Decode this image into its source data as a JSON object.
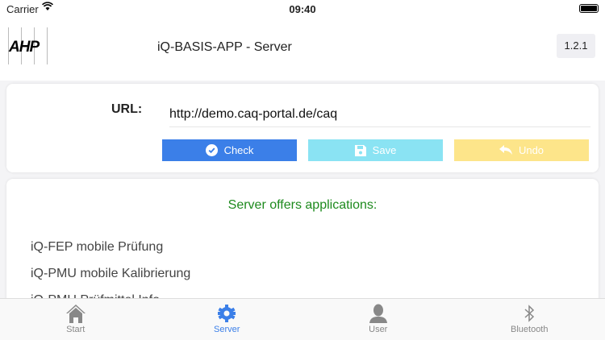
{
  "status": {
    "carrier": "Carrier",
    "time": "09:40"
  },
  "header": {
    "logo": "AHP",
    "title": "iQ-BASIS-APP - Server",
    "version": "1.2.1"
  },
  "server": {
    "url_label": "URL:",
    "url_value": "http://demo.caq-portal.de/caq",
    "check": "Check",
    "save": "Save",
    "undo": "Undo"
  },
  "apps": {
    "heading": "Server offers applications:",
    "items": [
      "iQ-FEP mobile Prüfung",
      "iQ-PMU mobile Kalibrierung",
      "iQ-PMU Prüfmittel Info"
    ]
  },
  "tabs": [
    {
      "label": "Start"
    },
    {
      "label": "Server"
    },
    {
      "label": "User"
    },
    {
      "label": "Bluetooth"
    }
  ],
  "colors": {
    "accent": "#3b7fe8",
    "check": "#3b7fe8",
    "save": "#8ae3f3",
    "undo": "#fde58a",
    "heading": "#1d8a1d"
  }
}
